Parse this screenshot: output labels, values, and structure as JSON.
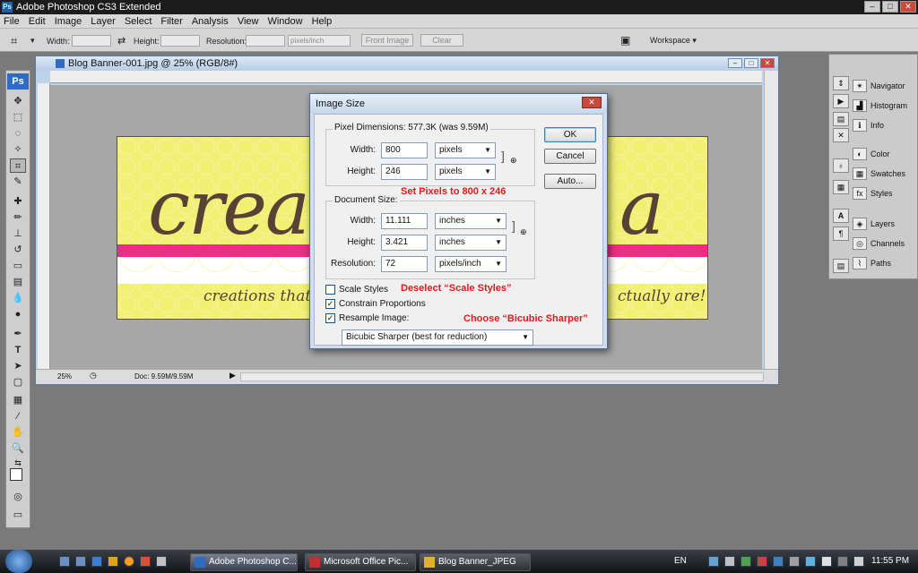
{
  "app": {
    "title": "Adobe Photoshop CS3 Extended",
    "logo": "Ps"
  },
  "menu": [
    "File",
    "Edit",
    "Image",
    "Layer",
    "Select",
    "Filter",
    "Analysis",
    "View",
    "Window",
    "Help"
  ],
  "options": {
    "width_label": "Width:",
    "height_label": "Height:",
    "resolution_label": "Resolution:",
    "units": "pixels/inch",
    "front_image": "Front Image",
    "clear": "Clear",
    "workspace": "Workspace ▾"
  },
  "document": {
    "title": "Blog Banner-001.jpg @ 25% (RGB/8#)",
    "zoom": "25%",
    "doc_info": "Doc: 9.59M/9.59M"
  },
  "banner": {
    "script_left": "creat",
    "script_right": "a",
    "tagline_left": "creations that",
    "tagline_right": "ctually are!"
  },
  "panels": [
    {
      "label": "Navigator",
      "icon": "navigator-icon"
    },
    {
      "label": "Histogram",
      "icon": "histogram-icon"
    },
    {
      "label": "Info",
      "icon": "info-icon"
    },
    {
      "label": "Color",
      "icon": "color-icon"
    },
    {
      "label": "Swatches",
      "icon": "swatches-icon"
    },
    {
      "label": "Styles",
      "icon": "styles-icon"
    },
    {
      "label": "Layers",
      "icon": "layers-icon"
    },
    {
      "label": "Channels",
      "icon": "channels-icon"
    },
    {
      "label": "Paths",
      "icon": "paths-icon"
    }
  ],
  "dialog": {
    "title": "Image Size",
    "pixel_dimensions": "Pixel Dimensions:  577.3K (was 9.59M)",
    "width_label": "Width:",
    "width_value": "800",
    "width_unit": "pixels",
    "height_label": "Height:",
    "height_value": "246",
    "height_unit": "pixels",
    "document_size": "Document Size:",
    "doc_width_label": "Width:",
    "doc_width_value": "11.111",
    "doc_width_unit": "inches",
    "doc_height_label": "Height:",
    "doc_height_value": "3.421",
    "doc_height_unit": "inches",
    "resolution_label": "Resolution:",
    "resolution_value": "72",
    "resolution_unit": "pixels/inch",
    "scale_styles": "Scale Styles",
    "scale_styles_checked": false,
    "constrain": "Constrain Proportions",
    "constrain_checked": true,
    "resample": "Resample Image:",
    "resample_checked": true,
    "resample_method": "Bicubic Sharper (best for reduction)",
    "ok": "OK",
    "cancel": "Cancel",
    "auto": "Auto...",
    "note_pixels": "Set Pixels to 800 x 246",
    "note_scale": "Deselect “Scale Styles”",
    "note_bicubic": "Choose “Bicubic Sharper”"
  },
  "taskbar": {
    "items": [
      "Adobe Photoshop C...",
      "Microsoft Office Pic...",
      "Blog Banner_JPEG"
    ],
    "lang": "EN",
    "time": "11:55 PM"
  },
  "colors": {
    "accent": "#ee2d86",
    "banner_bg": "#f2ef72",
    "script": "#5a4135",
    "annotation": "#e0191c"
  }
}
